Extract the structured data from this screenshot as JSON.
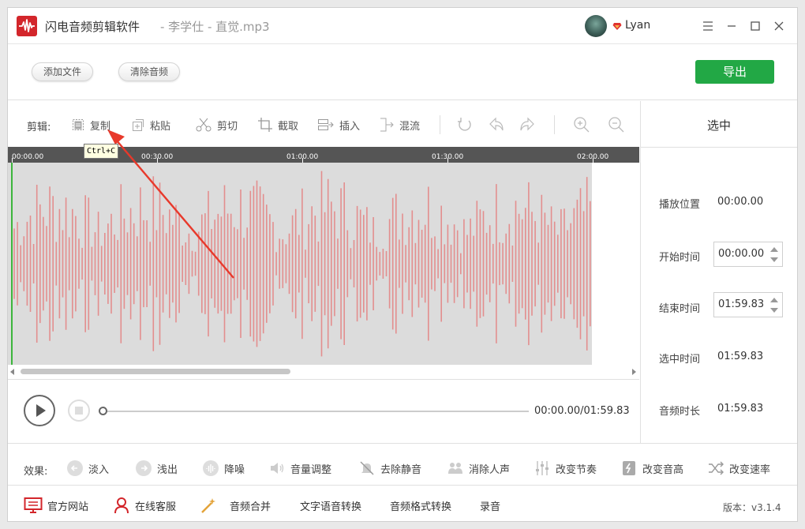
{
  "titlebar": {
    "app_name": "闪电音频剪辑软件",
    "file_name": "- 李学仕 - 直觉.mp3",
    "user_name": "Lyan"
  },
  "toolbar": {
    "add_file": "添加文件",
    "clear_audio": "清除音频",
    "export": "导出"
  },
  "edit": {
    "label": "剪辑:",
    "copy": "复制",
    "paste": "粘贴",
    "cut": "剪切",
    "crop": "截取",
    "insert": "插入",
    "mix": "混流",
    "tooltip": "Ctrl+C"
  },
  "timeline": {
    "ticks": [
      "00:00.00",
      "00:30.00",
      "01:00.00",
      "01:30.00",
      "02:00.00"
    ]
  },
  "player": {
    "time": "00:00.00/01:59.83",
    "progress": 0
  },
  "panel": {
    "title": "选中",
    "play_position_label": "播放位置",
    "play_position": "00:00.00",
    "start_label": "开始时间",
    "start": "00:00.00",
    "end_label": "结束时间",
    "end": "01:59.83",
    "selected_label": "选中时间",
    "selected": "01:59.83",
    "duration_label": "音频时长",
    "duration": "01:59.83"
  },
  "effects": {
    "label": "效果:",
    "fade_in": "淡入",
    "fade_out": "浅出",
    "denoise": "降噪",
    "volume": "音量调整",
    "remove_silence": "去除静音",
    "remove_vocal": "消除人声",
    "tempo": "改变节奏",
    "pitch": "改变音高",
    "speed": "改变速率"
  },
  "footer": {
    "website": "官方网站",
    "support": "在线客服",
    "merge": "音频合并",
    "tts": "文字语音转换",
    "format": "音频格式转换",
    "record": "录音",
    "version": "版本：v3.1.4"
  },
  "colors": {
    "brand_red": "#d3262b",
    "export_green": "#22a845",
    "wave": "#e38e8e",
    "playhead": "#3db53d"
  }
}
